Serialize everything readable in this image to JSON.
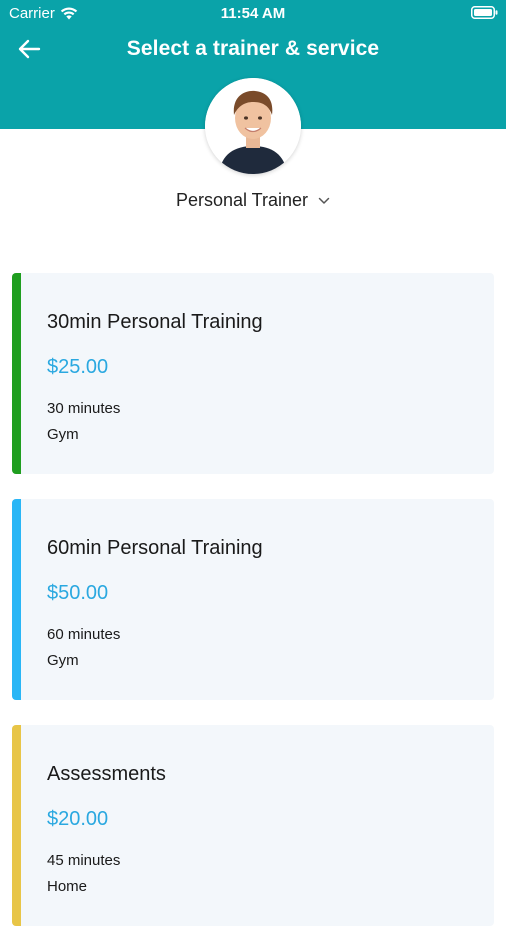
{
  "colors": {
    "accent": "#0aa3a9",
    "price": "#2aa8e0"
  },
  "status_bar": {
    "carrier": "Carrier",
    "time": "11:54 AM",
    "wifi_icon": "wifi-icon",
    "battery_icon": "battery-icon"
  },
  "nav": {
    "back_icon": "arrow-left-icon",
    "title": "Select a trainer & service"
  },
  "trainer": {
    "avatar": "trainer-avatar-photo",
    "name": "Personal Trainer",
    "dropdown_icon": "chevron-down-icon"
  },
  "services": [
    {
      "title": "30min Personal Training",
      "price": "$25.00",
      "duration": "30 minutes",
      "location": "Gym",
      "accent_color": "#1f9e1f"
    },
    {
      "title": "60min Personal Training",
      "price": "$50.00",
      "duration": "60 minutes",
      "location": "Gym",
      "accent_color": "#29b6f6"
    },
    {
      "title": "Assessments",
      "price": "$20.00",
      "duration": "45 minutes",
      "location": "Home",
      "accent_color": "#e8c547"
    }
  ]
}
